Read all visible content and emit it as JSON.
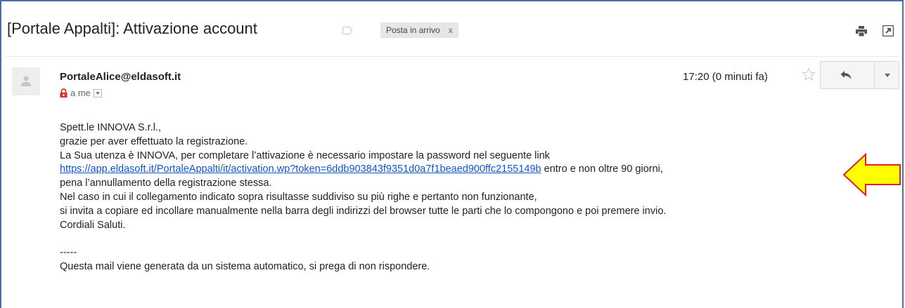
{
  "subject": "[Portale Appalti]: Attivazione account",
  "label": {
    "name": "Posta in arrivo",
    "remove": "x"
  },
  "toolbar_icons": [
    "print-icon",
    "open-new-window-icon"
  ],
  "message": {
    "sender": "PortaleAlice@eldasoft.it",
    "recipient": "a me",
    "time": "17:20 (0 minuti fa)",
    "body": {
      "greeting": "Spett.le INNOVA S.r.l.,",
      "line1": "grazie per aver effettuato la registrazione.",
      "line2": "La Sua utenza è INNOVA, per completare l’attivazione è necessario impostare la password nel seguente link",
      "link": "https://app.eldasoft.it/PortaleAppalti/it/activation.wp?token=6ddb903843f9351d0a7f1beaed900ffc2155149b",
      "link_suffix": " entro e non oltre 90 giorni,",
      "line3": "pena l’annullamento della registrazione stessa.",
      "line4": "Nel caso in cui il collegamento indicato sopra risultasse suddiviso su più righe e pertanto non funzionante,",
      "line5": "si invita a copiare ed incollare manualmente nella barra degli indirizzi del browser tutte le parti che lo compongono e poi premere invio.",
      "closing": "Cordiali Saluti.",
      "separator": "-----",
      "footer": "Questa mail viene generata da un sistema automatico, si prega di non rispondere."
    }
  },
  "colors": {
    "link": "#1155cc",
    "frame_border": "#4a6fa5",
    "arrow_fill": "#ffff00",
    "arrow_stroke": "#e0202a"
  }
}
